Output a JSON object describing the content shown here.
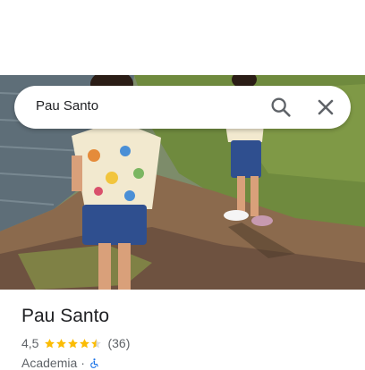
{
  "search": {
    "query": "Pau Santo"
  },
  "place": {
    "name": "Pau Santo",
    "rating": "4,5",
    "rating_fraction": 0.9,
    "review_count": "(36)",
    "category": "Academia",
    "separator": "·"
  },
  "icons": {
    "search": "search-icon",
    "close": "close-icon",
    "accessibility": "wheelchair-icon",
    "star": "star-icon"
  },
  "colors": {
    "star": "#fbbc04",
    "accessibility": "#1a73e8",
    "text": "#202124",
    "secondary": "#5f6368"
  }
}
